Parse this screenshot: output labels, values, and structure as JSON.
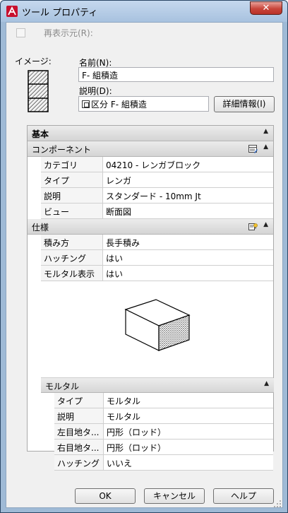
{
  "window": {
    "title": "ツール プロパティ",
    "close_label": "✕"
  },
  "top": {
    "redisplay_label": "再表示元(R):",
    "image_label": "イメージ:",
    "name_label": "名前(N):",
    "name_value": "F- 組積造",
    "desc_label": "説明(D):",
    "desc_value": "区分 F- 組積造",
    "details_button": "詳細情報(I)"
  },
  "palette": {
    "basic": {
      "header": "基本",
      "component": {
        "header": "コンポーネント",
        "rows": [
          {
            "key": "カテゴリ",
            "value": "04210 - レンガブロック"
          },
          {
            "key": "タイプ",
            "value": "レンガ"
          },
          {
            "key": "説明",
            "value": "スタンダード - 10mm Jt"
          },
          {
            "key": "ビュー",
            "value": "断面図"
          }
        ]
      }
    },
    "spec": {
      "header": "仕様",
      "rows": [
        {
          "key": "積み方",
          "value": "長手積み"
        },
        {
          "key": "ハッチング",
          "value": "はい"
        },
        {
          "key": "モルタル表示",
          "value": "はい"
        }
      ],
      "mortar": {
        "header": "モルタル",
        "rows": [
          {
            "key": "タイプ",
            "value": "モルタル"
          },
          {
            "key": "説明",
            "value": "モルタル"
          },
          {
            "key": "左目地タ...",
            "value": "円形（ロッド）"
          },
          {
            "key": "右目地タ...",
            "value": "円形（ロッド）"
          },
          {
            "key": "ハッチング",
            "value": "いいえ"
          }
        ]
      }
    }
  },
  "buttons": {
    "ok": "OK",
    "cancel": "キャンセル",
    "help": "ヘルプ"
  }
}
